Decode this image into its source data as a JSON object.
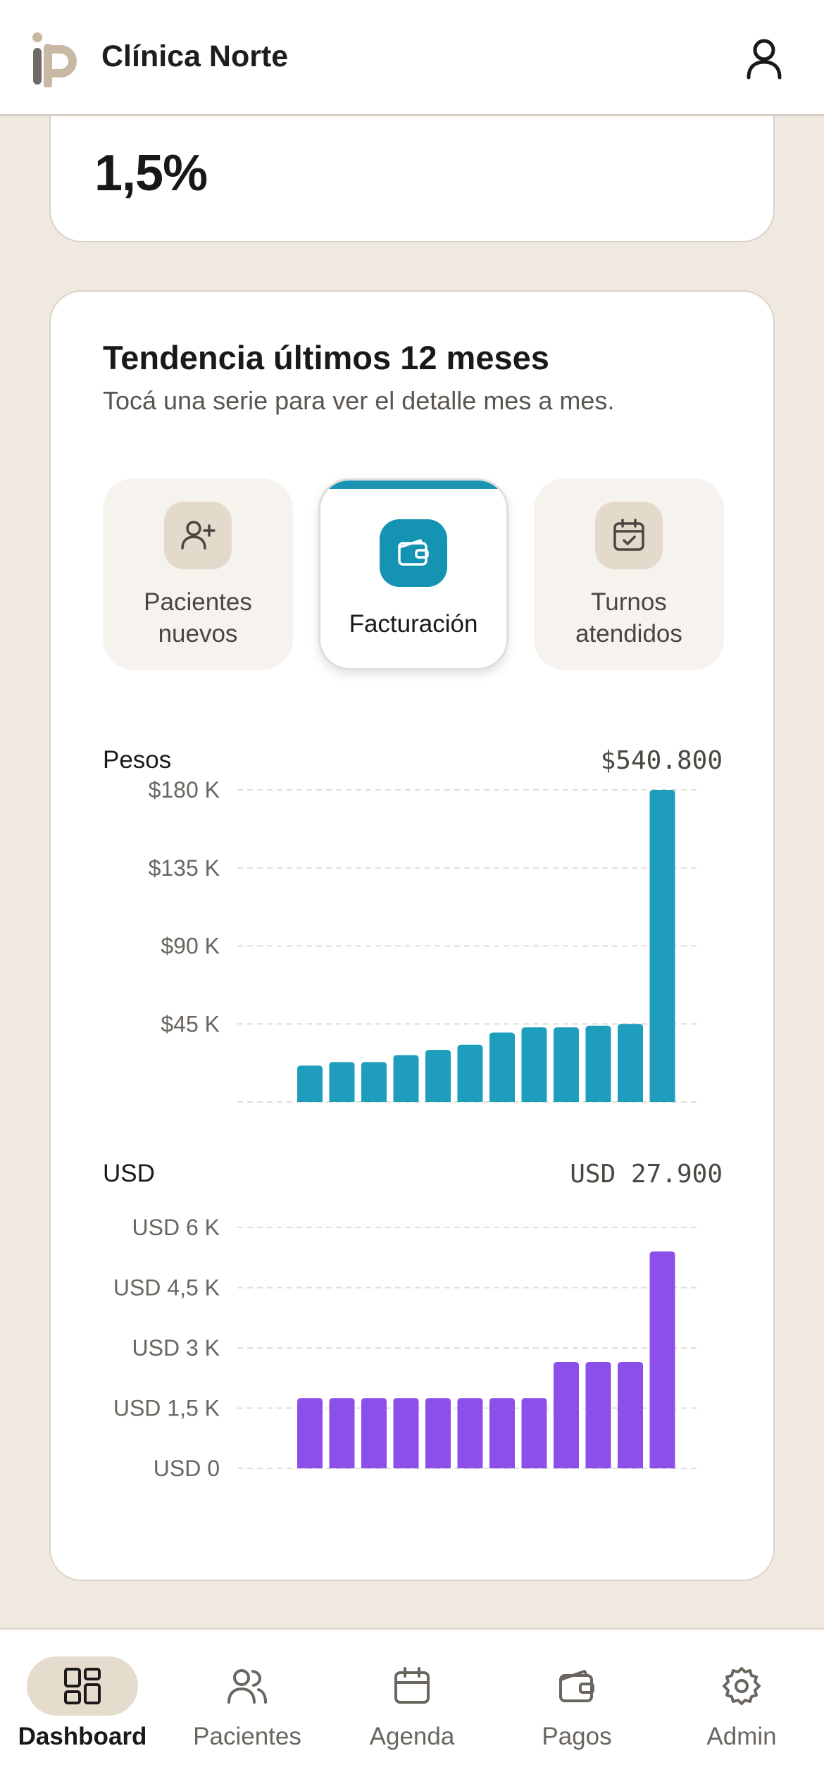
{
  "header": {
    "title": "Clínica Norte",
    "logo_icon": "ip-logo-icon",
    "user_icon": "user-icon"
  },
  "top_card": {
    "value": "1,5%"
  },
  "trend": {
    "title": "Tendencia últimos 12 meses",
    "subtitle": "Tocá una serie para ver el detalle mes a mes.",
    "tabs": [
      {
        "label_lines": [
          "Pacientes",
          "nuevos"
        ],
        "icon": "user-plus-icon",
        "active": false
      },
      {
        "label_lines": [
          "Facturación"
        ],
        "icon": "wallet-icon",
        "active": true
      },
      {
        "label_lines": [
          "Turnos",
          "atendidos"
        ],
        "icon": "calendar-check-icon",
        "active": false
      }
    ],
    "pesos": {
      "label": "Pesos",
      "total": "$540.800"
    },
    "usd": {
      "label": "USD",
      "total": "USD 27.900"
    }
  },
  "colors": {
    "accent": "#1493b3",
    "pesos_bar": "#1e9dbc",
    "usd_bar": "#8c4fea",
    "nav_active_bg": "#e6dccd"
  },
  "chart_data": [
    {
      "type": "bar",
      "series": [
        {
          "name": "Pesos",
          "values": [
            21000,
            23000,
            23000,
            27000,
            30000,
            33000,
            40000,
            43000,
            43000,
            44000,
            45000,
            180000
          ]
        }
      ],
      "yticks": [
        45000,
        90000,
        135000,
        180000
      ],
      "ytick_labels": [
        "$45 K",
        "$90 K",
        "$135 K",
        "$180 K"
      ],
      "ylim": [
        0,
        180000
      ],
      "grid": true
    },
    {
      "type": "bar",
      "series": [
        {
          "name": "USD",
          "values": [
            1750,
            1750,
            1750,
            1750,
            1750,
            1750,
            1750,
            1750,
            2650,
            2650,
            2650,
            5400
          ]
        }
      ],
      "yticks": [
        0,
        1500,
        3000,
        4500,
        6000
      ],
      "ytick_labels": [
        "USD 0",
        "USD 1,5 K",
        "USD 3 K",
        "USD 4,5 K",
        "USD 6 K"
      ],
      "ylim": [
        0,
        6000
      ],
      "grid": true
    }
  ],
  "nav": {
    "items": [
      {
        "label": "Dashboard",
        "icon": "dashboard-grid-icon",
        "active": true
      },
      {
        "label": "Pacientes",
        "icon": "users-icon",
        "active": false
      },
      {
        "label": "Agenda",
        "icon": "calendar-icon",
        "active": false
      },
      {
        "label": "Pagos",
        "icon": "wallet-icon",
        "active": false
      },
      {
        "label": "Admin",
        "icon": "gear-icon",
        "active": false
      }
    ]
  }
}
